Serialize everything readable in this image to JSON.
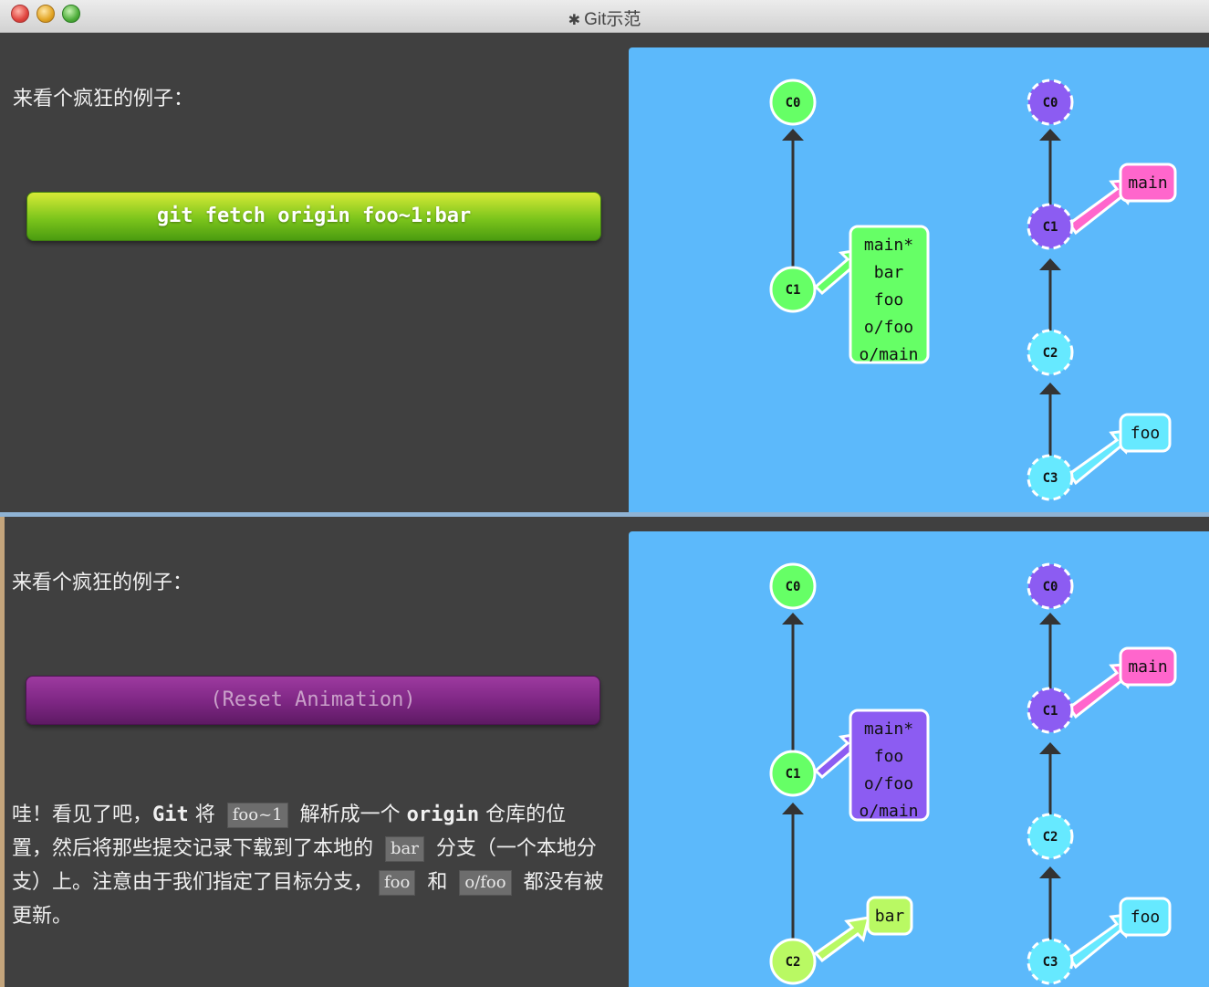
{
  "window": {
    "title": "Git示范",
    "icon": "gear-icon"
  },
  "top_panel": {
    "intro": "来看个疯狂的例子：",
    "command_button": "git fetch origin foo~1:bar",
    "graph": {
      "local": {
        "commits": [
          "C0",
          "C1"
        ],
        "branch_box": [
          "main*",
          "bar",
          "foo",
          "o/foo",
          "o/main"
        ]
      },
      "remote": {
        "commits": [
          "C0",
          "C1",
          "C2",
          "C3"
        ],
        "branches": [
          "main",
          "foo"
        ]
      }
    }
  },
  "bottom_panel": {
    "intro": "来看个疯狂的例子：",
    "reset_button": "(Reset Animation)",
    "explanation": {
      "p1": "哇！看见了吧，",
      "git": "Git",
      "p2": " 将 ",
      "code1": "foo~1",
      "p3": " 解析成一个 ",
      "origin": "origin",
      "p4": " 仓库的位置，然后将那些提交记录下载到了本地的 ",
      "code2": "bar",
      "p5": " 分支（一个本地分支）上。注意由于我们指定了目标分支，",
      "code3": "foo",
      "p6": " 和 ",
      "code4": "o/foo",
      "p7": " 都没有被更新。"
    },
    "graph": {
      "local": {
        "commits": [
          "C0",
          "C1",
          "C2"
        ],
        "branch_box": [
          "main*",
          "foo",
          "o/foo",
          "o/main"
        ],
        "bar_label": "bar"
      },
      "remote": {
        "commits": [
          "C0",
          "C1",
          "C2",
          "C3"
        ],
        "branches": [
          "main",
          "foo"
        ]
      }
    }
  },
  "colors": {
    "local_commit": "#66ff66",
    "remote_root": "#8c5cf2",
    "remote_new": "#66e9ff",
    "main_label": "#ff66cc",
    "foo_label": "#66e9ff",
    "bar_label": "#b9f963",
    "bar_commit": "#b9f963",
    "canvas": "#5cb9fb"
  }
}
